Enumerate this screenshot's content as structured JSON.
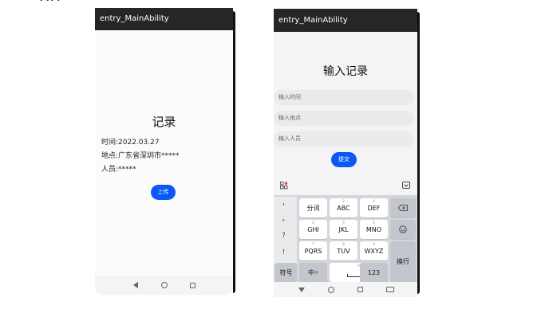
{
  "corner_mark": "• •• •",
  "left_phone": {
    "app_title": "entry_MainAbility",
    "heading": "记录",
    "time_label": "时间:",
    "time_value": "2022.03.27",
    "place_label": "地点:",
    "place_value": "广东省深圳市*****",
    "person_label": "人员:",
    "person_value": "*****",
    "upload_label": "上传",
    "nav": [
      "back-icon",
      "home-icon",
      "recents-icon"
    ]
  },
  "right_phone": {
    "app_title": "entry_MainAbility",
    "heading": "输入记录",
    "fields": {
      "time_placeholder": "输入时间",
      "place_placeholder": "输入地点",
      "person_placeholder": "输入人员"
    },
    "submit_label": "提交",
    "keyboard": {
      "punctuation": [
        "，",
        "。",
        "？",
        "！"
      ],
      "row1": [
        {
          "main": "分词",
          "sub": ""
        },
        {
          "main": "ABC",
          "sub": "2"
        },
        {
          "main": "DEF",
          "sub": "3"
        }
      ],
      "row2": [
        {
          "main": "GHI",
          "sub": "4"
        },
        {
          "main": "JKL",
          "sub": "5"
        },
        {
          "main": "MNO",
          "sub": "6"
        }
      ],
      "row3": [
        {
          "main": "PQRS",
          "sub": "7"
        },
        {
          "main": "TUV",
          "sub": "8"
        },
        {
          "main": "WXYZ",
          "sub": "9"
        }
      ],
      "symbols_label": "符号",
      "chinese_label": "中",
      "chinese_sub": "英",
      "space_sub": "0",
      "num_label": "123",
      "enter_label": "换行",
      "backspace_icon": "backspace-icon",
      "emoji_icon": "emoji-icon"
    },
    "nav": [
      "down-arrow-icon",
      "home-icon",
      "recents-icon",
      "keyboard-icon"
    ]
  }
}
